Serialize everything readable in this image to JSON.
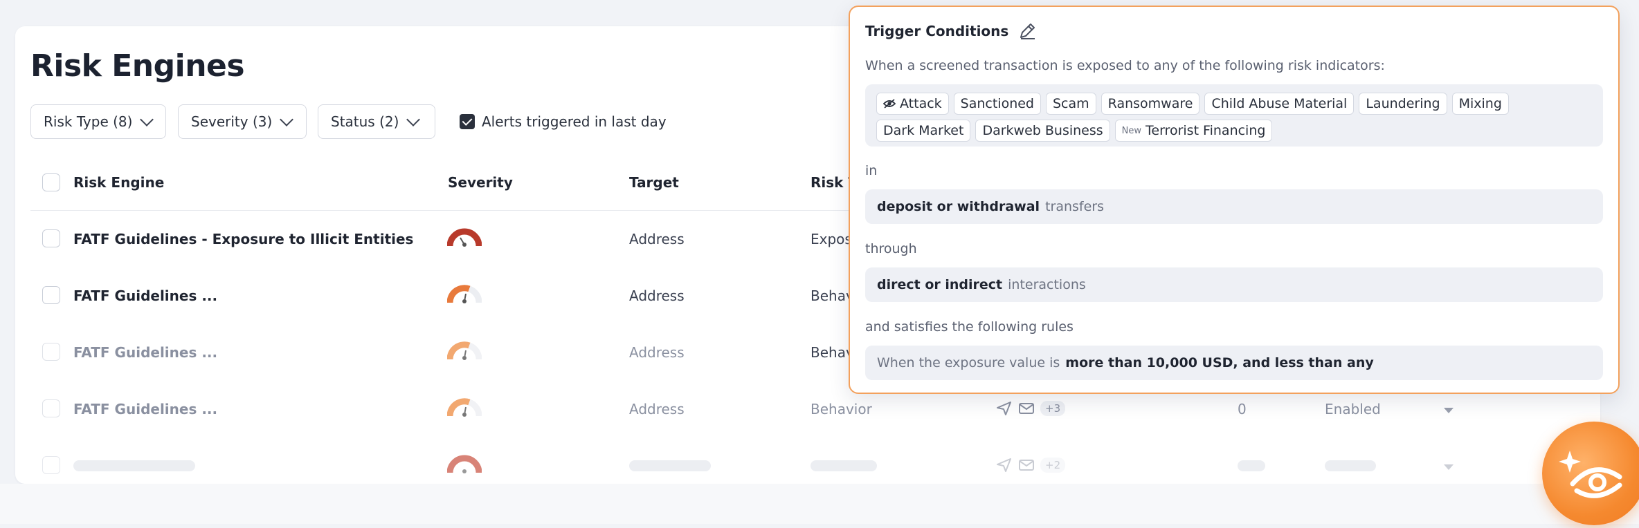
{
  "page": {
    "title": "Risk Engines"
  },
  "filters": {
    "risk_type": "Risk Type (8)",
    "severity": "Severity (3)",
    "status": "Status (2)",
    "alerts_toggle": "Alerts triggered in last day"
  },
  "table": {
    "headers": {
      "risk_engine": "Risk Engine",
      "severity": "Severity",
      "target": "Target",
      "risk_type": "Risk T"
    },
    "rows": [
      {
        "name": "FATF Guidelines - Exposure to Illicit Entities",
        "target": "Address",
        "risk_type": "Expos",
        "severity_color": "#b83a2b"
      },
      {
        "name": "FATF Guidelines ...",
        "target": "Address",
        "risk_type": "Behav",
        "severity_color": "#e87a3c"
      },
      {
        "name": "FATF Guidelines ...",
        "target": "Address",
        "risk_type": "Behav",
        "severity_color": "#f2a870"
      },
      {
        "name": "FATF Guidelines ...",
        "target": "Address",
        "risk_type": "Behavior",
        "count": "0",
        "status": "Enabled",
        "extra": "+3",
        "severity_color": "#f2a870"
      },
      {
        "extra": "+2",
        "severity_color": "#cc5a4a"
      }
    ]
  },
  "popover": {
    "title": "Trigger Conditions",
    "intro": "When a screened transaction is exposed to any of the following risk indicators:",
    "tags": [
      {
        "label": "Attack",
        "icon": "eye-icon"
      },
      {
        "label": "Sanctioned"
      },
      {
        "label": "Scam"
      },
      {
        "label": "Ransomware"
      },
      {
        "label": "Child Abuse Material"
      },
      {
        "label": "Laundering"
      },
      {
        "label": "Mixing"
      },
      {
        "label": "Dark Market"
      },
      {
        "label": "Darkweb Business"
      },
      {
        "label": "Terrorist Financing",
        "badge": "New"
      }
    ],
    "in_label": "in",
    "in_value_bold": "deposit or withdrawal",
    "in_value_muted": "transfers",
    "through_label": "through",
    "through_value_bold": "direct or indirect",
    "through_value_muted": "interactions",
    "rules_label": "and satisfies the following rules",
    "rules_prefix": "When the exposure value is",
    "rules_value": "more than 10,000 USD, and less than any"
  },
  "colors": {
    "accent": "#f3a15d",
    "orb": "#f5892f"
  }
}
